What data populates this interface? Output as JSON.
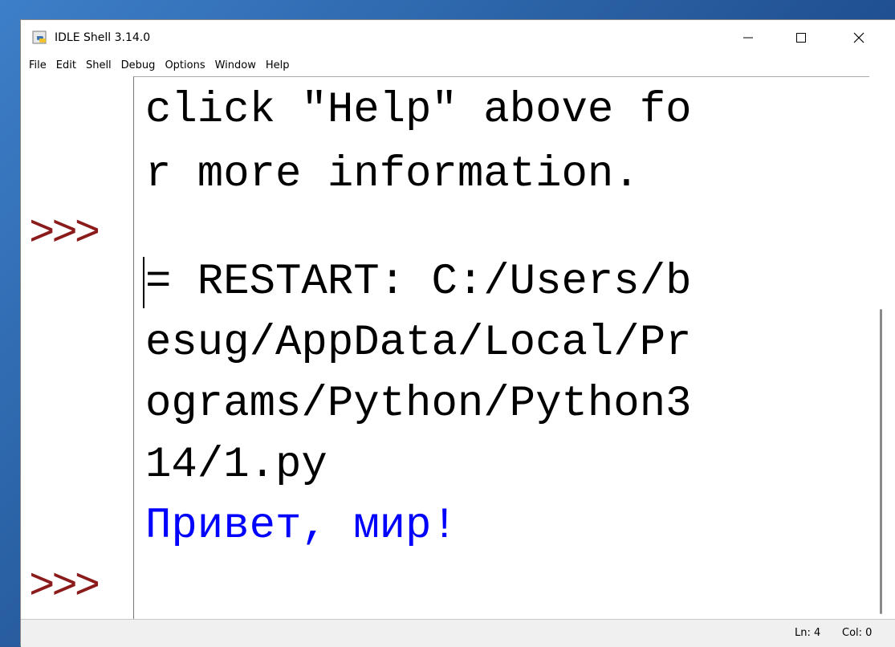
{
  "window": {
    "title": "IDLE Shell 3.14.0",
    "minimize_glyph": "—",
    "maximize_glyph": "☐",
    "close_glyph": "✕"
  },
  "menu": {
    "items": [
      "File",
      "Edit",
      "Shell",
      "Debug",
      "Options",
      "Window",
      "Help"
    ]
  },
  "shell": {
    "lines": [
      "click \"Help\" above fo",
      "r more information.",
      "= RESTART: C:/Users/b",
      "esug/AppData/Local/Pr",
      "ograms/Python/Python3",
      "14/1.py",
      "Привет, мир!"
    ],
    "prompt": ">>>",
    "output_color": "#0000ff",
    "prompt_color": "#8b1a1a"
  },
  "status": {
    "line": "Ln: 4",
    "col": "Col: 0"
  }
}
